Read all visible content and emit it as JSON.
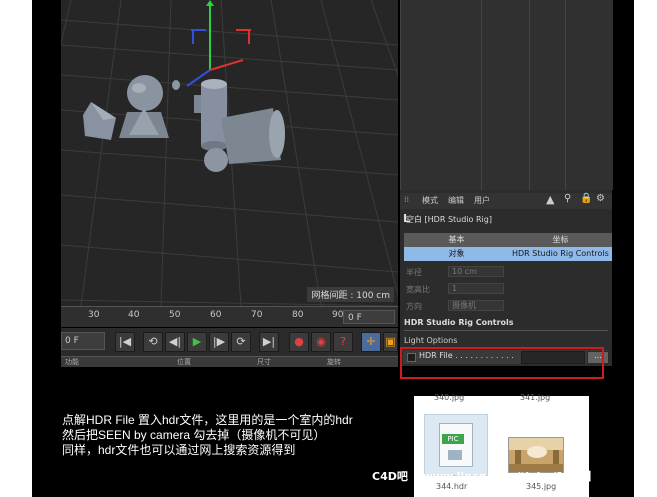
{
  "viewport": {
    "grid_spacing_label": "网格间距 : 100 cm"
  },
  "timeline": {
    "ticks": [
      "30",
      "40",
      "50",
      "60",
      "70",
      "80",
      "90"
    ],
    "frame_field": "0 F"
  },
  "transport": {
    "frame_field": "0 F",
    "icons": [
      "go-to-start-icon",
      "step-back-icon",
      "play-backward-icon",
      "play-icon",
      "play-forward-icon",
      "step-forward-icon",
      "go-to-end-icon",
      "record-icon",
      "autokey-icon",
      "keyframe-icon",
      "move-tool-icon"
    ]
  },
  "under_bar": {
    "items": [
      "功能",
      "位置",
      "尺寸",
      "旋转"
    ]
  },
  "attributes": {
    "menu": [
      "模式",
      "编辑",
      "用户"
    ],
    "object_title": "空白 [HDR Studio Rig]",
    "tabs": {
      "basic": "基本",
      "coord": "坐标",
      "object": "对象",
      "rig_controls": "HDR Studio Rig Controls"
    },
    "props": {
      "radius_label": "半径",
      "radius_value": "10 cm",
      "aspect_label": "宽高比",
      "aspect_value": "1",
      "direction_label": "方向",
      "direction_value": "摄像机"
    },
    "section_title": "HDR Studio Rig Controls",
    "light_options": "Light Options",
    "hdr_file_label": "HDR File . . . . . . . . . . . .",
    "browse_label": "..."
  },
  "caption": {
    "line1": "点解HDR File 置入hdr文件，这里用的是一个室内的hdr",
    "line2": "然后把SEEN by camera 勾去掉（摄像机不可见）",
    "line3": "同样，hdr文件也可以通过网上搜索资源得到"
  },
  "file_browser": {
    "top_left": "340.jpg",
    "top_right": "341.jpg",
    "bottom_left": "344.hdr",
    "bottom_right": "345.jpg",
    "badge": "PIC"
  },
  "watermark": "C4D吧 【www.lincg.com/tieba/1799】",
  "colors": {
    "accent_blue": "#8fb9e8",
    "tab_blue": "#4b6b9c",
    "red_highlight": "#d01c1c",
    "play_green": "#3ec24a"
  }
}
